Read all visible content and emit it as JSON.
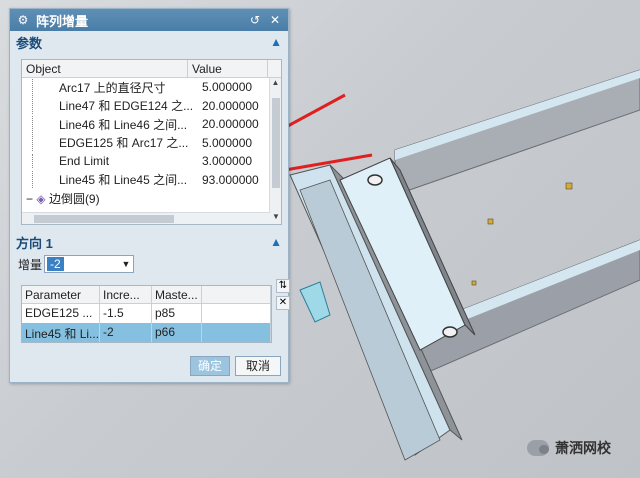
{
  "dialog": {
    "title": "阵列增量",
    "params_section": "参数",
    "grid1": {
      "headers": [
        "Object",
        "Value"
      ],
      "rows": [
        {
          "object": "Arc17 上的直径尺寸",
          "value": "5.000000"
        },
        {
          "object": "Line47 和 EDGE124 之...",
          "value": "20.000000"
        },
        {
          "object": "Line46 和 Line46 之间...",
          "value": "20.000000"
        },
        {
          "object": "EDGE125 和 Arc17 之...",
          "value": "5.000000"
        },
        {
          "object": "End Limit",
          "value": "3.000000"
        },
        {
          "object": "Line45 和 Line45 之间...",
          "value": "93.000000"
        }
      ],
      "tree_node": "边倒圆(9)"
    },
    "direction_section": "方向 1",
    "increment_label": "增量",
    "increment_value": "-2",
    "grid2": {
      "headers": [
        "Parameter",
        "Incre...",
        "Maste..."
      ],
      "rows": [
        {
          "parameter": "EDGE125 ...",
          "increment": "-1.5",
          "master": "p85"
        },
        {
          "parameter": "Line45 和 Li...",
          "increment": "-2",
          "master": "p66"
        }
      ]
    },
    "ok_label": "确定",
    "cancel_label": "取消"
  },
  "watermark": "萧洒网校",
  "colors": {
    "title_bar": "#4a7ea8",
    "selected_row": "#86c0e0",
    "arrow": "#e02020"
  }
}
